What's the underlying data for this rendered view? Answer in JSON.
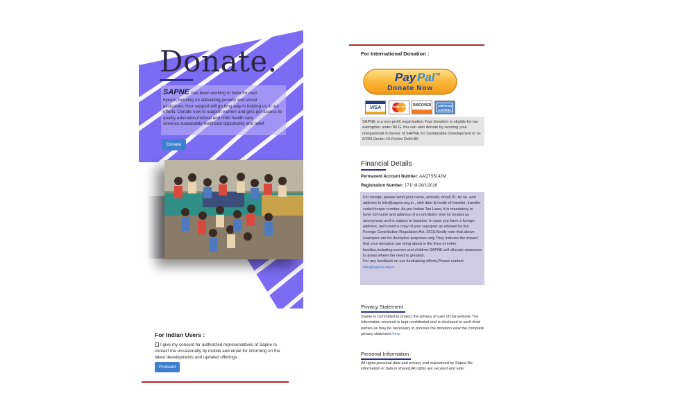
{
  "left": {
    "title": "Donate.",
    "intro": {
      "brand": "SAPNE",
      "text": "has been working in India for over 6years,focusing on alleviating poverty and social exclusions.Your support will go long way in helping us in our efforts. Donate now to support women and girls get access to quality education,meteral and child health care services,sustainable livelihood opportunity and relief"
    },
    "donate_button": "Donate",
    "indian_users": {
      "title": "For Indian Users :",
      "consent": "I give my consent for authorized representatives of Sapne to contact me occasionally by mobile and email for informing on the latest developments and updated offerings.",
      "proceed_button": "Proceed"
    },
    "colors": {
      "hero_purple": "#7c6cf4",
      "button_blue": "#3f7fd0",
      "rule_red": "#b0282a"
    }
  },
  "right": {
    "intl_title": "For International Donation :",
    "paypal": {
      "brand": "PayPal",
      "tm": "TM",
      "action": "Donate Now"
    },
    "cards": [
      "VISA",
      "MasterCard",
      "DISCOVER",
      "AMERICAN EXPRESS"
    ],
    "intl_note": "SAPNE is a non-profit organisation.Your donation is eligible for tax exemption under 80 G.You can also donate by sending your cheque/draft in favour of SAPNE for Sustainable Development to G-6/203,Sector-16,Rohini Delhi 89",
    "financial": {
      "title": "Financial Details",
      "pan_label": "Permanent Account Number:",
      "pan_value": "AAQTS5142M",
      "reg_label": "Registration Number:",
      "reg_value": "171/ dt-16/1/2016",
      "receipt_text": "For receipt, please send your name, amount, email ID, tel no. and address to info@sapne.org.in , with date & mode of transfer, transfer code/cheque number. As per Indian Tax Laws, it is mandatory to have full name and address of a contributor else its treated as anonymous and is subject to taxation. In case you have a foreign address, we'll need a copy of your passport as advised by the Foreign Contribution Regulation Act, 2010.Kindly note that above examples are for decriptive purposes only.They indicate the impact that your donation can bring about in the lives of entire families,including women and children,SAPNE will allocate resources to areas where the need is greatest.",
      "feedback_text": "For any feedback on our fundraising efforts,Please contact",
      "feedback_email": "info@sapne.org.in"
    },
    "privacy": {
      "title": "Privacy Statement",
      "text": "Sapne is committed to protect the privacy of user of this website.The Information received is kept confidential and is disclosed to such third parties as may be necessary to process the donation view the complete privacy statement",
      "link": "here"
    },
    "personal": {
      "title": "Personal Information",
      "text": "All rights,personal data and privacy and maintained by Sapne.No information or data is shared,All rights are secured and safe."
    }
  }
}
